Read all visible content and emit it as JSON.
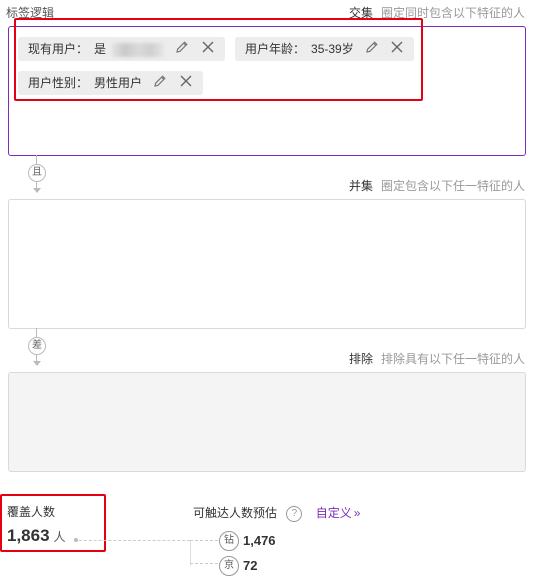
{
  "intersection": {
    "section_title": "标签逻辑",
    "op_label": "交集",
    "op_desc": "圈定同时包含以下特征的人",
    "chips": [
      {
        "name": "现有用户：",
        "value": "是"
      },
      {
        "name": "用户年龄：",
        "value": "35-39岁"
      },
      {
        "name": "用户性别：",
        "value": "男性用户"
      }
    ]
  },
  "connector_and": "且",
  "union": {
    "op_label": "并集",
    "op_desc": "圈定包含以下任一特征的人"
  },
  "connector_minus": "差",
  "exclude": {
    "op_label": "排除",
    "op_desc": "排除具有以下任一特征的人"
  },
  "coverage": {
    "label": "覆盖人数",
    "value": "1,863",
    "unit": "人"
  },
  "reach": {
    "label": "可触达人数预估",
    "help_icon": "?",
    "link_text": "自定义",
    "link_arrow": "»",
    "items": [
      {
        "badge": "钻",
        "value": "1,476"
      },
      {
        "badge": "京",
        "value": "72"
      }
    ]
  },
  "colors": {
    "accent": "#7b2cb9",
    "highlight": "#e60012"
  }
}
